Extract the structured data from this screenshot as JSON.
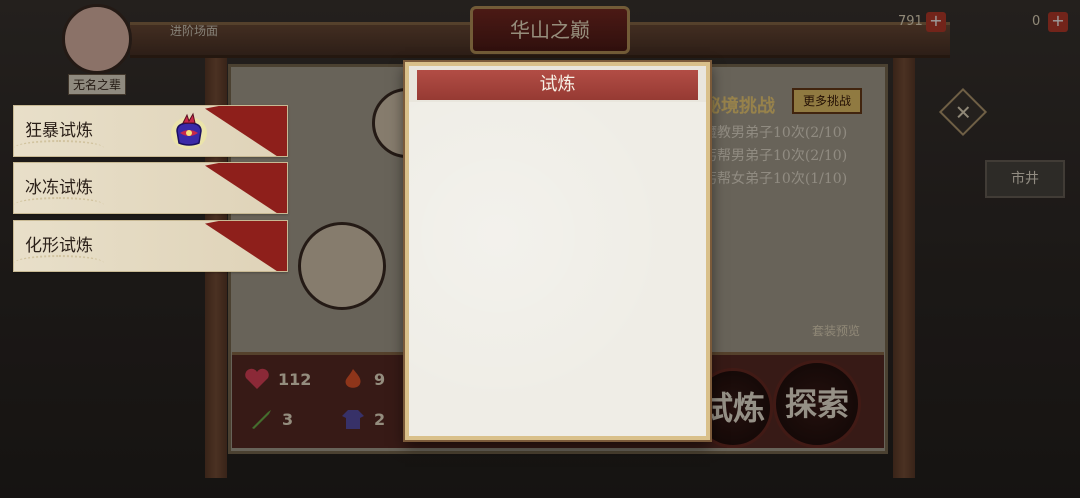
{
  "header": {
    "title": "华山之巅"
  },
  "player": {
    "status_text": "进阶场面",
    "nameplate": "无名之辈"
  },
  "resources": [
    {
      "id": "gold",
      "value": "791"
    },
    {
      "id": "ingot",
      "value": "0"
    }
  ],
  "challenge": {
    "title": "秘境挑战",
    "more_button": "更多挑战",
    "tasks": [
      "魔教男弟子10次(2/10)",
      "丐帮男弟子10次(2/10)",
      "丐帮女弟子10次(1/10)"
    ]
  },
  "side": {
    "close_label": "✕",
    "market_label": "市井",
    "preview_label": "套装预览"
  },
  "stats": {
    "hp": "112",
    "fire": "9",
    "attack": "3",
    "defense": "2"
  },
  "actions": {
    "trial_label": "试炼",
    "explore_label": "探索"
  },
  "modal": {
    "title": "试炼",
    "items": [
      {
        "label": "狂暴试炼",
        "has_reward": true
      },
      {
        "label": "冰冻试炼",
        "has_reward": false
      },
      {
        "label": "化形试炼",
        "has_reward": false
      }
    ]
  },
  "colors": {
    "modal_header": "#a8433c",
    "item_corner": "#8e1f1b",
    "frame_gold": "#d9c08a"
  }
}
